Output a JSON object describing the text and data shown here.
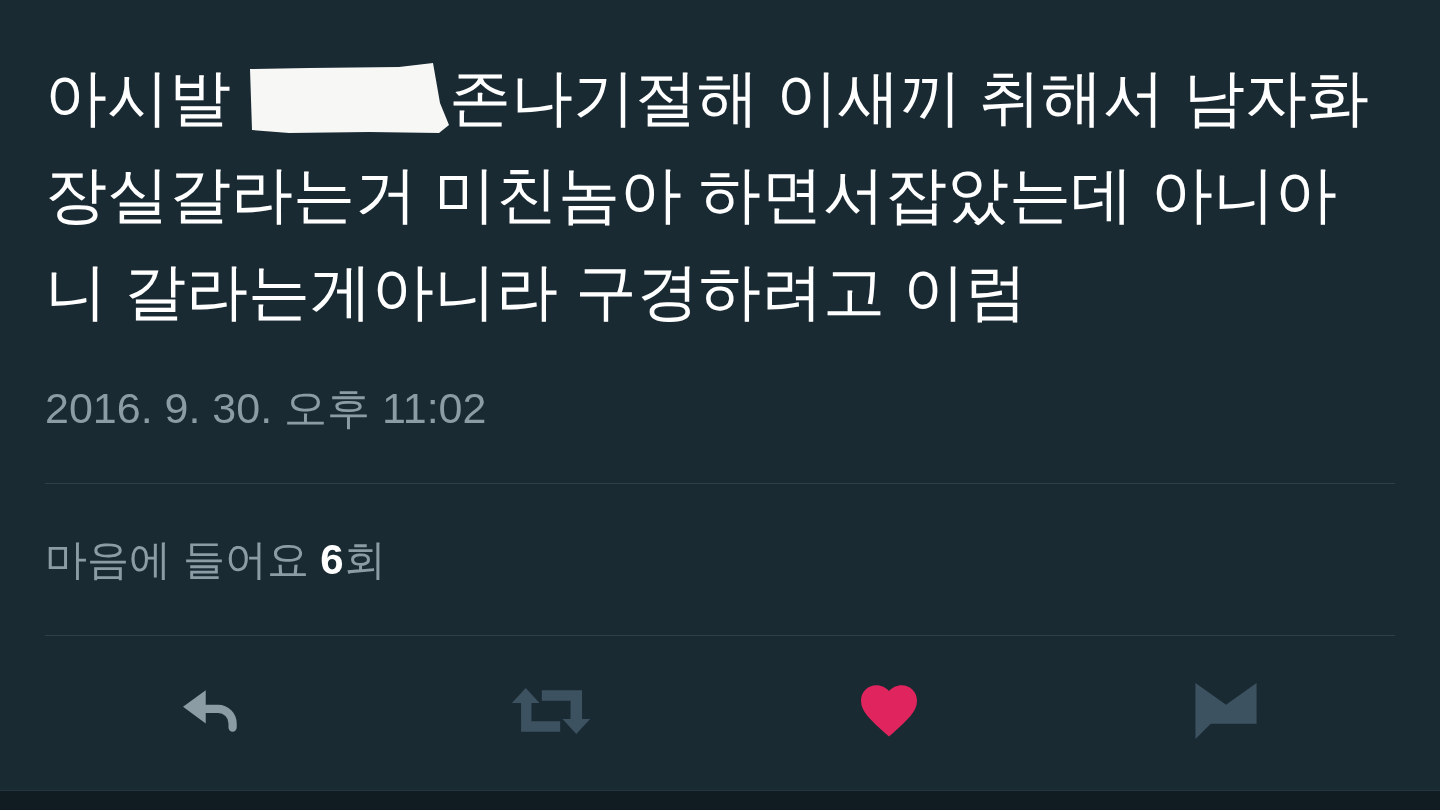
{
  "tweet": {
    "text_lines": [
      {
        "segments": [
          {
            "kind": "text",
            "text": "아시발"
          },
          {
            "kind": "redaction"
          },
          {
            "kind": "text",
            "text": "존나기절해 이새끼 취해서 남자화"
          }
        ]
      },
      {
        "segments": [
          {
            "kind": "text",
            "text": "장실갈라는거 미친놈아 하면서잡았는데 아니아"
          }
        ]
      },
      {
        "segments": [
          {
            "kind": "text",
            "text": "니 갈라는게아니라 구경하려고 이럼"
          }
        ]
      }
    ],
    "timestamp": "2016. 9. 30. 오후 11:02",
    "likes_summary": "마음에 들어요 **6**회",
    "actions": [
      {
        "kind": "reply",
        "active": false,
        "disabled": false
      },
      {
        "kind": "retweet",
        "active": false,
        "disabled": true
      },
      {
        "kind": "like",
        "active": true,
        "disabled": false
      },
      {
        "kind": "message",
        "active": false,
        "disabled": true
      }
    ]
  }
}
